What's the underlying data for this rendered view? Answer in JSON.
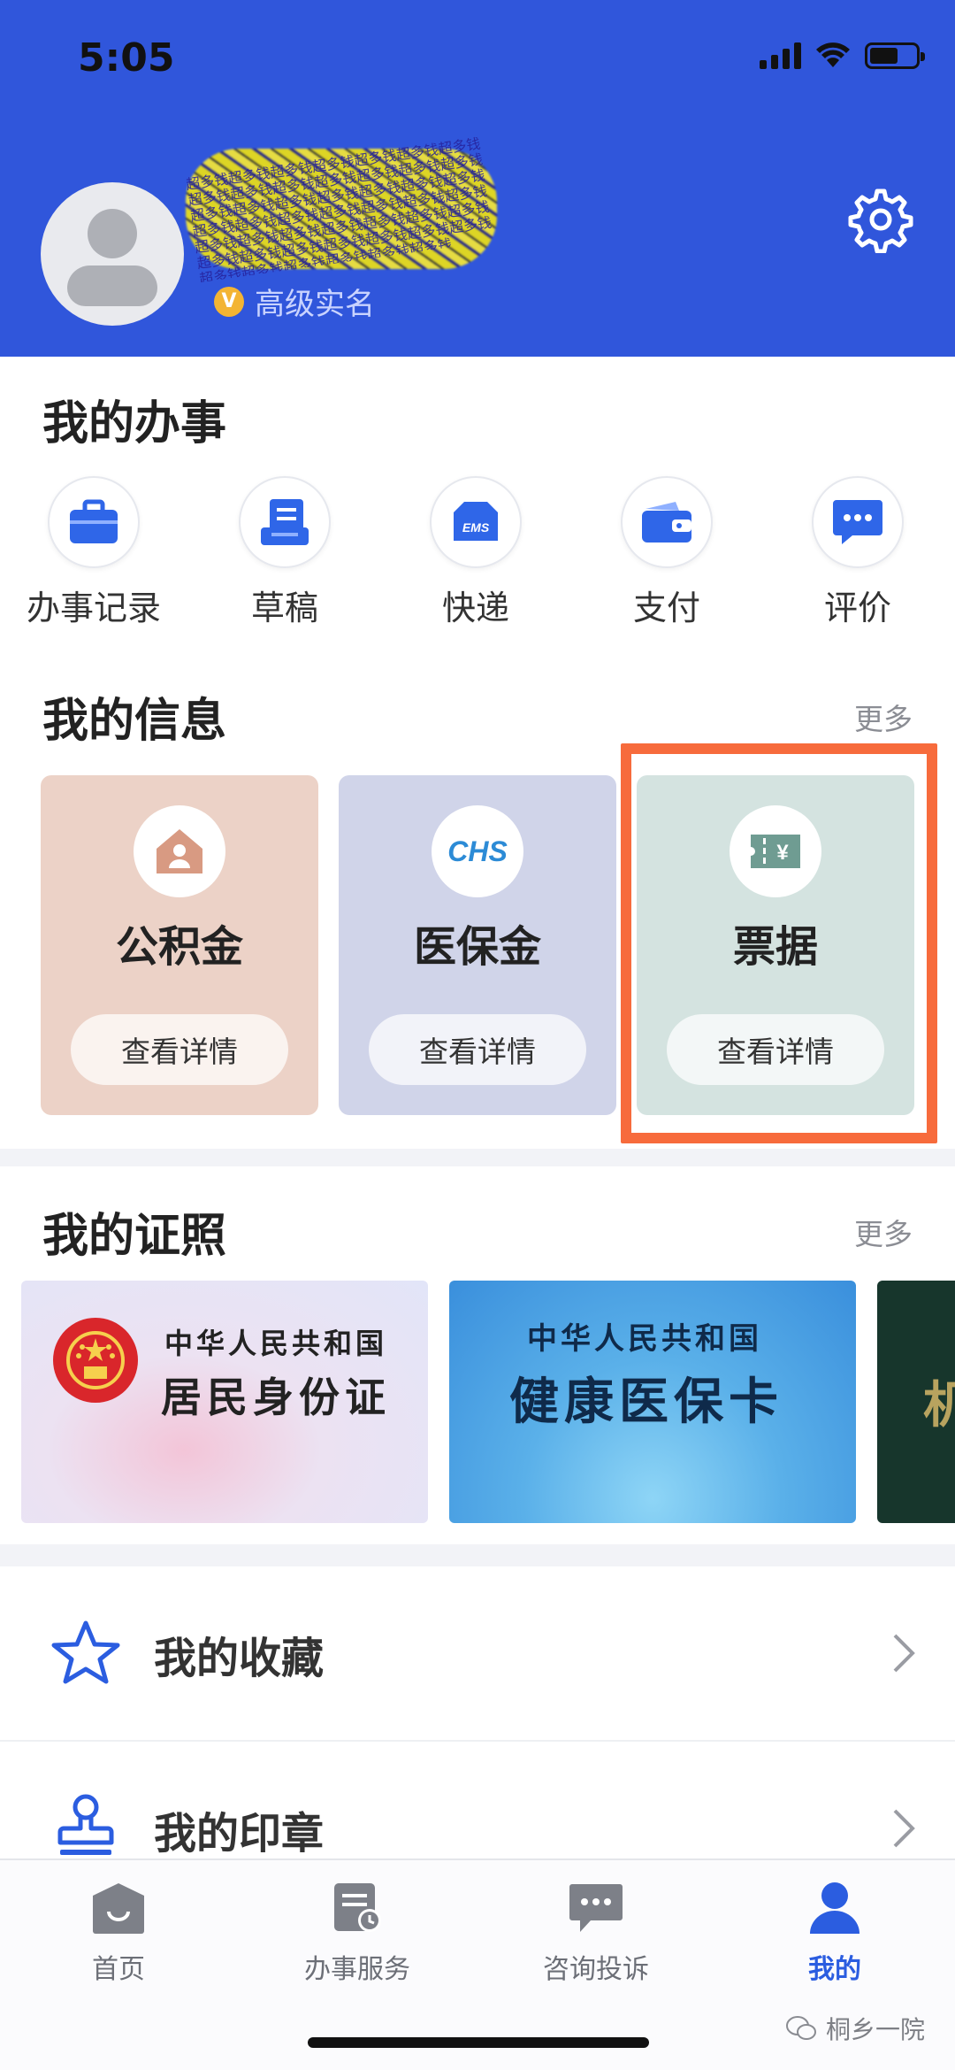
{
  "status_bar": {
    "time": "5:05"
  },
  "profile": {
    "verification": "高级实名",
    "verification_badge": "V",
    "redaction_glyphs": "超多钱超多钱超多钱超多钱超多钱超多钱超多钱超多钱超多钱超多钱超多钱超多钱超多钱超多钱超多钱超多钱超多钱超多钱超多钱超多钱超多钱超多钱超多钱超多钱超多钱超多钱超多钱超多钱超多钱超多钱超多钱超多钱超多钱超多钱超多钱超多钱超多钱超多钱超多钱超多钱超多钱超多钱超多钱超多钱超多钱超多钱超多钱超多钱"
  },
  "my_tasks": {
    "title": "我的办事",
    "items": [
      {
        "label": "办事记录",
        "icon": "briefcase-icon"
      },
      {
        "label": "草稿",
        "icon": "draft-icon"
      },
      {
        "label": "快递",
        "icon": "ems-icon",
        "icon_text": "EMS"
      },
      {
        "label": "支付",
        "icon": "wallet-icon"
      },
      {
        "label": "评价",
        "icon": "comment-icon"
      }
    ]
  },
  "my_info": {
    "title": "我的信息",
    "more": "更多",
    "cards": [
      {
        "title": "公积金",
        "button": "查看详情",
        "icon": "house-icon",
        "bg": "#ecd2c7"
      },
      {
        "title": "医保金",
        "button": "查看详情",
        "icon": "chs-icon",
        "icon_text": "CHS",
        "bg": "#d0d4e9"
      },
      {
        "title": "票据",
        "button": "查看详情",
        "icon": "receipt-icon",
        "icon_text": "¥",
        "bg": "#d4e3e0"
      }
    ]
  },
  "my_licenses": {
    "title": "我的证照",
    "more": "更多",
    "cards": [
      {
        "line1": "中华人民共和国",
        "line2": "居民身份证"
      },
      {
        "line1": "中华人民共和国",
        "line2": "健康医保卡"
      },
      {
        "line2": "机"
      }
    ]
  },
  "list": [
    {
      "label": "我的收藏",
      "icon": "star-icon"
    },
    {
      "label": "我的印章",
      "icon": "seal-icon"
    }
  ],
  "tabbar": {
    "tabs": [
      {
        "label": "首页",
        "icon": "home-icon"
      },
      {
        "label": "办事服务",
        "icon": "service-icon"
      },
      {
        "label": "咨询投诉",
        "icon": "chat-icon"
      },
      {
        "label": "我的",
        "icon": "user-icon"
      }
    ],
    "active_index": 3
  },
  "watermark": "桐乡一院",
  "colors": {
    "brand": "#3056db",
    "highlight": "#f76b3c",
    "active_tab": "#2b5de0"
  }
}
